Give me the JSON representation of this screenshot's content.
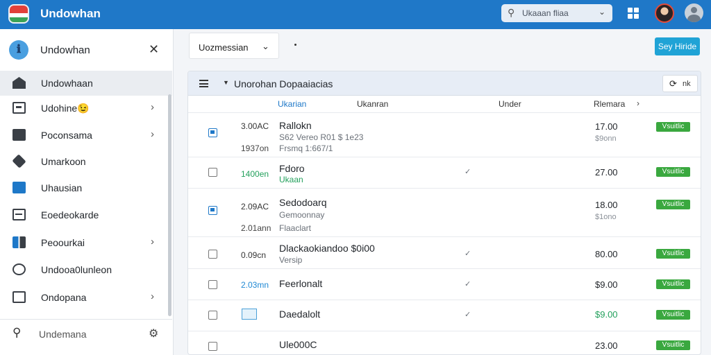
{
  "app": {
    "title": "Undowhan"
  },
  "topbar": {
    "search_placeholder": "Ukaaan fliaa"
  },
  "sidebar": {
    "title": "Undowhan",
    "items": [
      {
        "label": "Undowhaan",
        "icon": "home-icon",
        "arrow": false
      },
      {
        "label": "Udohine😉",
        "icon": "card-icon",
        "arrow": true
      },
      {
        "label": "Poconsama",
        "icon": "document-icon",
        "arrow": true
      },
      {
        "label": "Umarkoon",
        "icon": "tag-icon",
        "arrow": false
      },
      {
        "label": "Uhausian",
        "icon": "file-icon",
        "arrow": false
      },
      {
        "label": "Eoedeokarde",
        "icon": "minus-box-icon",
        "arrow": false
      },
      {
        "label": "Peoourkai",
        "icon": "book-icon",
        "arrow": true
      },
      {
        "label": "Undooa0lunleon",
        "icon": "camera-icon",
        "arrow": false
      },
      {
        "label": "Ondopana",
        "icon": "terminal-icon",
        "arrow": true
      }
    ],
    "search_placeholder": "Undemana"
  },
  "toolbar": {
    "dropdown_label": "Uozmessian",
    "primary_button": "Sey Hiride"
  },
  "panel": {
    "title": "Unorohan Dopaaiacias",
    "button_label": "nk",
    "columns": [
      "Ukarian",
      "Ukanran",
      "Under",
      "Rlemara"
    ]
  },
  "rows": [
    {
      "checked": true,
      "num": "3.00AC",
      "num2": "1937on",
      "name": "Rallokn",
      "sub": "S62 Vereo R01 $ 1e23",
      "sub2": "Frsmq 1:667/1",
      "check": "",
      "price": "17.00",
      "price2": "$9onn",
      "badge": "Vsuitlic"
    },
    {
      "checked": false,
      "num": "1400en",
      "num_color": "green",
      "name": "Fdoro",
      "sub": "Ukaan",
      "sub_color": "green",
      "check": "✓",
      "price": "27.00",
      "badge": "Vsuitlic"
    },
    {
      "checked": true,
      "num": "2.09AC",
      "num2": "2.01ann",
      "name": "Sedodoarq",
      "sub": "Gemoonnay",
      "sub2": "Flaaclart",
      "check": "",
      "price": "18.00",
      "price2": "$1ono",
      "badge": "Vsuitlic"
    },
    {
      "checked": false,
      "num": "0.09cn",
      "name": "Dlackaokiandoo $0i00",
      "sub": "Versip",
      "check": "✓",
      "price": "80.00",
      "badge": "Vsuitlic"
    },
    {
      "checked": false,
      "num": "2.03mn",
      "num_color": "blue",
      "name": "Feerlonalt",
      "check": "✓",
      "price": "$9.00",
      "badge": "Vsuitlic"
    },
    {
      "checked": false,
      "thumb": true,
      "name": "Daedalolt",
      "check": "✓",
      "price": "$9.00",
      "price_color": "green",
      "badge": "Vsuitlic"
    },
    {
      "checked": false,
      "name": "Ule000C",
      "check": "",
      "price": "23.00",
      "badge": "Vsuitlic"
    }
  ]
}
